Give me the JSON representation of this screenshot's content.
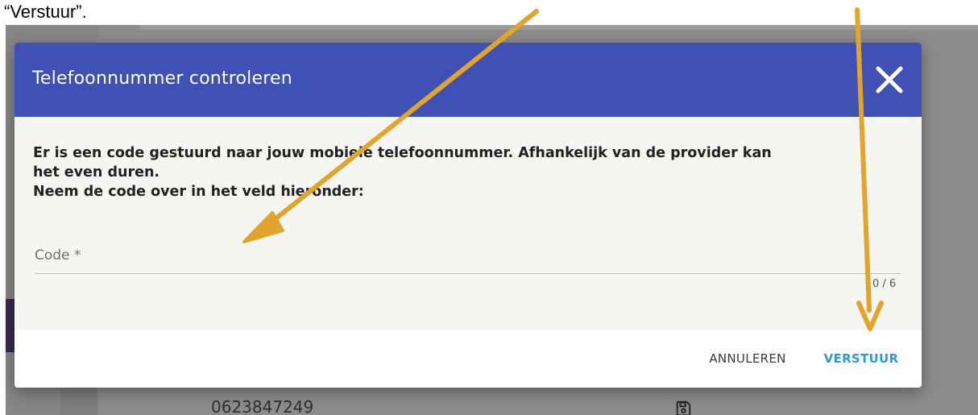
{
  "caption": "“Verstuur”.",
  "background": {
    "phone_number": "0623847249"
  },
  "dialog": {
    "title": "Telefoonnummer controleren",
    "message_lines": [
      "Er is een code gestuurd naar jouw mobiele telefoonnummer. Afhankelijk van de provider kan",
      "het even duren.",
      "Neem de code over in het veld hieronder:"
    ],
    "code_field": {
      "label": "Code *",
      "value": "",
      "counter": "0 / 6"
    },
    "buttons": {
      "cancel": "ANNULEREN",
      "submit": "VERSTUUR"
    }
  },
  "colors": {
    "header": "#4051b5",
    "submit_text": "#2c9ad2",
    "annotation_arrow": "#e2a42a"
  },
  "icons": {
    "close": "close-icon",
    "save": "save-icon",
    "arrows": "annotation-arrow"
  }
}
